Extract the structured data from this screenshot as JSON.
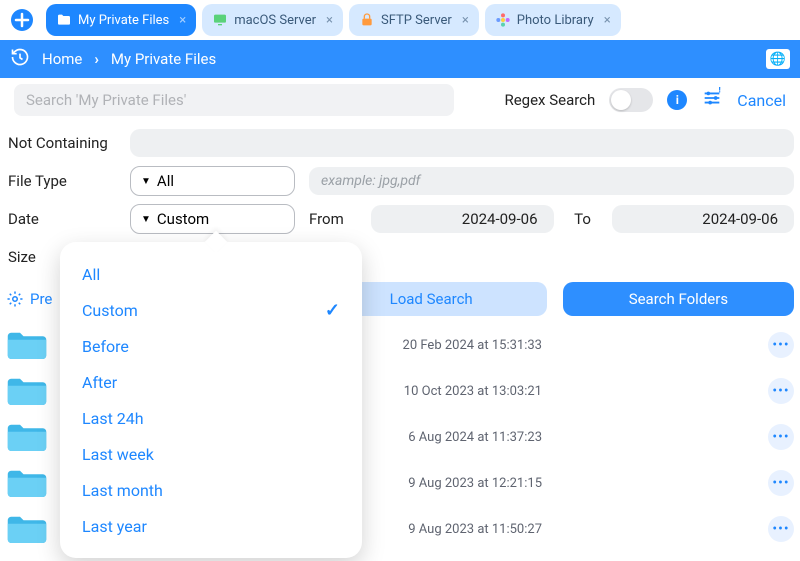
{
  "tabs": {
    "add_icon": "plus",
    "items": [
      {
        "label": "My Private Files",
        "active": true,
        "icon": "folder"
      },
      {
        "label": "macOS Server",
        "active": false,
        "icon": "monitor"
      },
      {
        "label": "SFTP Server",
        "active": false,
        "icon": "lock"
      },
      {
        "label": "Photo Library",
        "active": false,
        "icon": "flower"
      }
    ]
  },
  "breadcrumb": {
    "home": "Home",
    "current": "My Private Files"
  },
  "search": {
    "placeholder": "Search 'My Private Files'",
    "regex_label": "Regex Search",
    "cancel": "Cancel"
  },
  "filters": {
    "not_containing": {
      "label": "Not Containing",
      "value": ""
    },
    "file_type": {
      "label": "File Type",
      "selected": "All",
      "example": "example: jpg,pdf"
    },
    "date": {
      "label": "Date",
      "selected": "Custom",
      "from_label": "From",
      "from_value": "2024-09-06",
      "to_label": "To",
      "to_value": "2024-09-06",
      "options": [
        "All",
        "Custom",
        "Before",
        "After",
        "Last 24h",
        "Last week",
        "Last month",
        "Last year"
      ],
      "options_selected_index": 1
    },
    "size": {
      "label": "Size"
    }
  },
  "presets_label": "Pre",
  "action_buttons": {
    "save": "",
    "load": "Load Search",
    "search_folders": "Search Folders"
  },
  "files": [
    {
      "date": "20 Feb 2024 at 15:31:33"
    },
    {
      "date": "10 Oct 2023 at 13:03:21"
    },
    {
      "date": "6 Aug 2024 at 11:37:23"
    },
    {
      "date": "9 Aug 2023 at 12:21:15"
    },
    {
      "date": "9 Aug 2023 at 11:50:27"
    }
  ]
}
